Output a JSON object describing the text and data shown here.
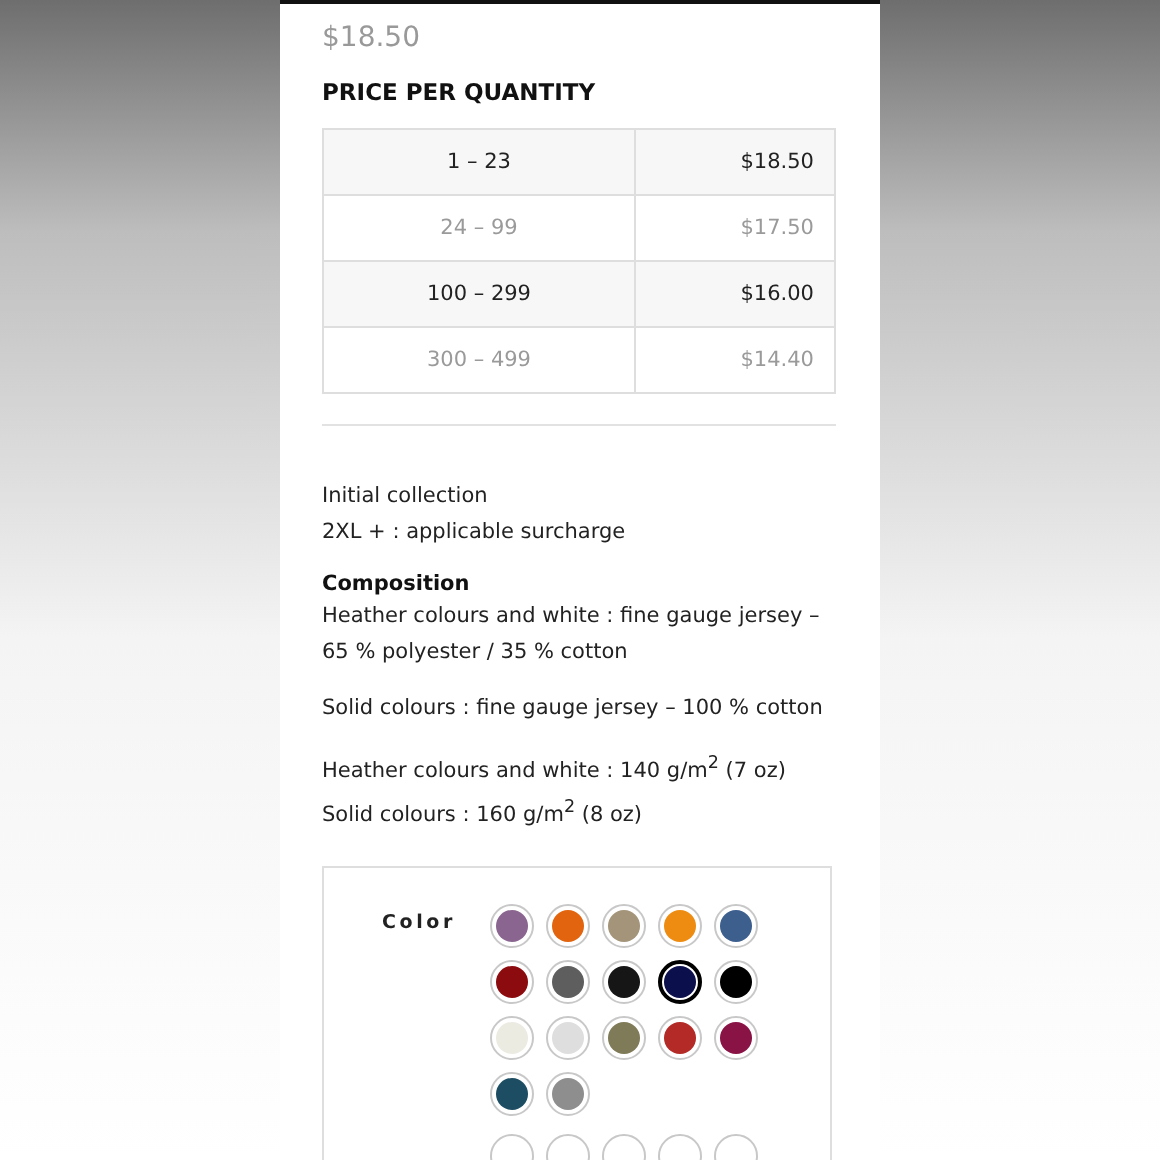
{
  "price": "$18.50",
  "price_table": {
    "title": "PRICE PER QUANTITY",
    "rows": [
      {
        "quantity": "1 – 23",
        "price": "$18.50"
      },
      {
        "quantity": "24 – 99",
        "price": "$17.50"
      },
      {
        "quantity": "100 – 299",
        "price": "$16.00"
      },
      {
        "quantity": "300 – 499",
        "price": "$14.40"
      }
    ]
  },
  "notes": [
    "Initial collection",
    "2XL + : applicable surcharge"
  ],
  "composition": {
    "title": "Composition",
    "paragraphs": [
      [
        "Heather colours and white : fine gauge jersey – 65 % polyester / 35 % cotton"
      ],
      [
        "Solid colours : fine gauge jersey – 100 % cotton"
      ],
      [
        "Heather colours and white : 140 g/m$^{2}$ (7 oz)",
        "Solid colours : 160 g/m$^{2}$ (8 oz)"
      ]
    ]
  },
  "color_picker": {
    "label": "Color",
    "swatches": [
      {
        "color": "#8a6590",
        "selected": false
      },
      {
        "color": "#e2640e",
        "selected": false
      },
      {
        "color": "#a49479",
        "selected": false
      },
      {
        "color": "#ee8c12",
        "selected": false
      },
      {
        "color": "#3d5f8e",
        "selected": false
      },
      {
        "color": "#8c0b0e",
        "selected": false
      },
      {
        "color": "#5e5e5e",
        "selected": false
      },
      {
        "color": "#161616",
        "selected": false
      },
      {
        "color": "#0b0f4c",
        "selected": true
      },
      {
        "color": "#000000",
        "selected": false
      },
      {
        "color": "#ecebe2",
        "selected": false
      },
      {
        "color": "#dedede",
        "selected": false
      },
      {
        "color": "#7f7a58",
        "selected": false
      },
      {
        "color": "#b32a26",
        "selected": false
      },
      {
        "color": "#8a1346",
        "selected": false
      },
      {
        "color": "#1d4d63",
        "selected": false
      },
      {
        "color": "#8e8e8e",
        "selected": false
      }
    ]
  }
}
